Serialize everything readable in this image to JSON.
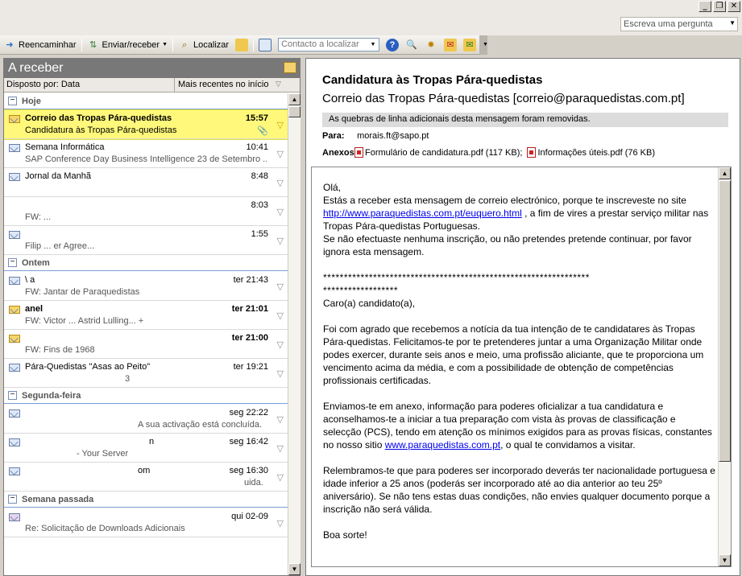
{
  "window": {
    "minimize": "_",
    "restore": "❐",
    "close": "✕",
    "ask_placeholder": "Escreva uma pergunta"
  },
  "toolbar": {
    "forward": "Reencaminhar",
    "send_receive": "Enviar/receber",
    "find": "Localizar",
    "contact_placeholder": "Contacto a localizar"
  },
  "folder": {
    "title": "A receber",
    "sort_by": "Disposto por: Data",
    "sort_order": "Mais recentes no início"
  },
  "groups": {
    "today": "Hoje",
    "yesterday": "Ontem",
    "monday": "Segunda-feira",
    "last_week": "Semana passada"
  },
  "messages": [
    {
      "from": "Correio das Tropas Pára-quedistas",
      "time": "15:57",
      "subject": "Candidatura às Tropas Pára-quedistas",
      "attachment": "📎"
    },
    {
      "from": "Semana Informática",
      "time": "10:41",
      "subject": "SAP Conference Day  Business Intelligence 23 de Setembro ..."
    },
    {
      "from": "Jornal da Manhã",
      "time": "8:48",
      "subject": ""
    },
    {
      "from": "",
      "time": "8:03",
      "subject": "FW: ..."
    },
    {
      "from": "",
      "time": "1:55",
      "subject": "Filip ... er Agree..."
    },
    {
      "from": "\\  a",
      "time": "ter 21:43",
      "subject": "FW: Jantar de Paraquedistas"
    },
    {
      "from": "   anel",
      "time": "ter 21:01",
      "subject": "FW: Victor ...  Astrid Lulling... +"
    },
    {
      "from": "",
      "time": "ter 21:00",
      "subject": "FW: Fins de 1968"
    },
    {
      "from": "Pára-Quedistas \"Asas ao Peito\"",
      "time": "ter 19:21",
      "subject": "3"
    },
    {
      "from": "",
      "time": "seg 22:22",
      "subject": "A sua activação está concluída."
    },
    {
      "from": "n",
      "time": "seg 16:42",
      "subject": "- Your Server"
    },
    {
      "from": "om",
      "time": "seg 16:30",
      "subject": "uida."
    },
    {
      "from": "",
      "time": "qui 02-09",
      "subject": "Re: Solicitação de Downloads Adicionais"
    }
  ],
  "reading": {
    "subject": "Candidatura às Tropas Pára-quedistas",
    "from": "Correio das Tropas Pára-quedistas [correio@paraquedistas.com.pt]",
    "info": "As quebras de linha adicionais desta mensagem foram removidas.",
    "to_label": "Para:",
    "to": "morais.ft@sapo.pt",
    "att_label": "Anexos:",
    "att1": "Formulário de candidatura.pdf (117 KB);",
    "att2": "Informações úteis.pdf (76 KB)",
    "greeting": "Olá,",
    "p1a": "Estás a receber esta mensagem de correio electrónico, porque te inscreveste no site ",
    "link1": "http://www.paraquedistas.com.pt/euquero.html",
    "p1b": " , a fim de vires a prestar serviço militar nas Tropas Pára-quedistas Portuguesas.",
    "p1c": "Se não efectuaste nenhuma inscrição, ou não pretendes pretende continuar, por favor ignora esta mensagem.",
    "stars1": "****************************************************************",
    "stars2": "******************",
    "salutation": "Caro(a) candidato(a),",
    "p2": "Foi com agrado que recebemos a notícia da tua intenção de te candidatares às Tropas Pára-quedistas. Felicitamos-te por te pretenderes juntar a uma Organização Militar onde podes exercer, durante seis anos e meio, uma profissão aliciante, que te proporciona um vencimento acima da média, e com a possibilidade de obtenção de competências profissionais certificadas.",
    "p3a": "Enviamos-te em anexo, informação para poderes oficializar a tua candidatura e aconselhamos-te a iniciar a tua preparação com vista às provas de classificação e selecção (PCS), tendo em atenção os mínimos exigidos para as provas físicas, constantes no nosso sitio ",
    "link2": "www.paraquedistas.com.pt",
    "p3b": ", o qual te convidamos a visitar.",
    "p4": "Relembramos-te que para poderes ser incorporado deverás ter nacionalidade portuguesa e idade inferior a 25 anos (poderás ser incorporado até ao dia anterior ao teu 25º aniversário). Se não tens estas duas condições, não envies qualquer documento porque a inscrição não será válida.",
    "closing": "Boa sorte!"
  }
}
